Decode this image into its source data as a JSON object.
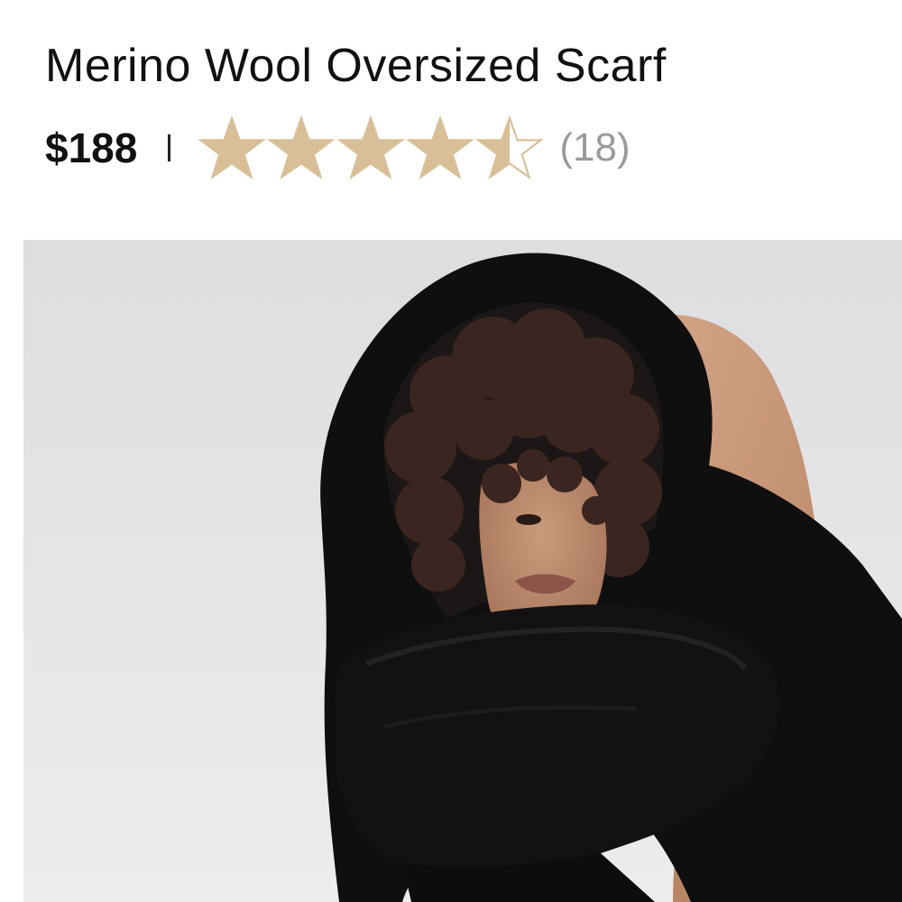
{
  "product": {
    "title": "Merino Wool Oversized Scarf",
    "price": "$188",
    "rating": {
      "value": 4.5,
      "max": 5,
      "review_count": "(18)",
      "star_color": "#d8bf97"
    }
  },
  "image": {
    "alt": "Model with curly hair wrapped in a black oversized scarf pulled over her head"
  },
  "colors": {
    "background": "#ffffff",
    "text": "#111111",
    "muted_text": "#9a9a9a",
    "star_empty": "#d8bf97"
  }
}
